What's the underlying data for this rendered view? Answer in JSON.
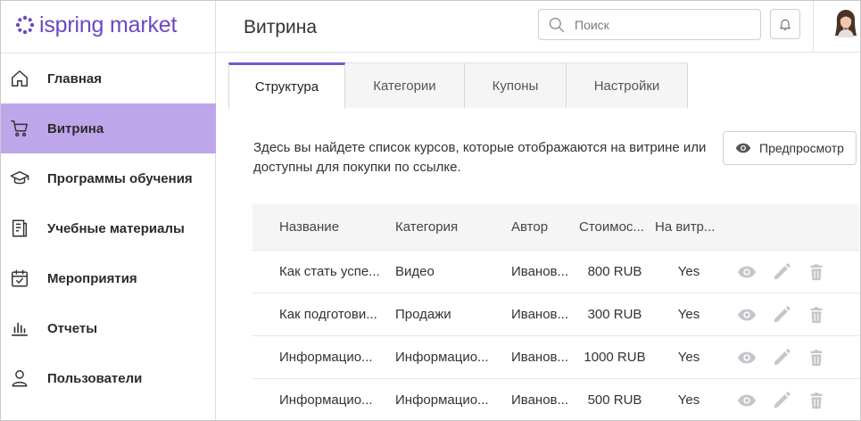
{
  "app": {
    "logo_part1": "ispring",
    "logo_part2": "market"
  },
  "header": {
    "title": "Витрина",
    "search_placeholder": "Поиск"
  },
  "sidebar": {
    "items": [
      {
        "label": "Главная",
        "icon": "home-icon",
        "active": false
      },
      {
        "label": "Витрина",
        "icon": "cart-icon",
        "active": true
      },
      {
        "label": "Программы обучения",
        "icon": "graduation-cap-icon",
        "active": false
      },
      {
        "label": "Учебные материалы",
        "icon": "document-icon",
        "active": false
      },
      {
        "label": "Мероприятия",
        "icon": "calendar-icon",
        "active": false
      },
      {
        "label": "Отчеты",
        "icon": "bar-chart-icon",
        "active": false
      },
      {
        "label": "Пользователи",
        "icon": "user-icon",
        "active": false
      }
    ]
  },
  "tabs": [
    {
      "label": "Структура",
      "active": true
    },
    {
      "label": "Категории",
      "active": false
    },
    {
      "label": "Купоны",
      "active": false
    },
    {
      "label": "Настройки",
      "active": false
    }
  ],
  "content": {
    "description": "Здесь вы найдете список курсов, которые отображаются на витрине или доступны для покупки по ссылке.",
    "preview_label": "Предпросмотр"
  },
  "table": {
    "headers": {
      "name": "Название",
      "category": "Категория",
      "author": "Автор",
      "price": "Стоимос...",
      "visible": "На витр..."
    },
    "rows": [
      {
        "name": "Как стать успе...",
        "category": "Видео",
        "author": "Иванов...",
        "price": "800 RUB",
        "visible": "Yes"
      },
      {
        "name": "Как подготови...",
        "category": "Продажи",
        "author": "Иванов...",
        "price": "300 RUB",
        "visible": "Yes"
      },
      {
        "name": "Информацио...",
        "category": "Информацио...",
        "author": "Иванов...",
        "price": "1000 RUB",
        "visible": "Yes"
      },
      {
        "name": "Информацио...",
        "category": "Информацио...",
        "author": "Иванов...",
        "price": "500 RUB",
        "visible": "Yes"
      }
    ]
  },
  "colors": {
    "brand": "#6c47c7",
    "active_nav": "#bea6ea",
    "tab_accent": "#7a55cf",
    "action_icon": "#c3c6cb"
  }
}
